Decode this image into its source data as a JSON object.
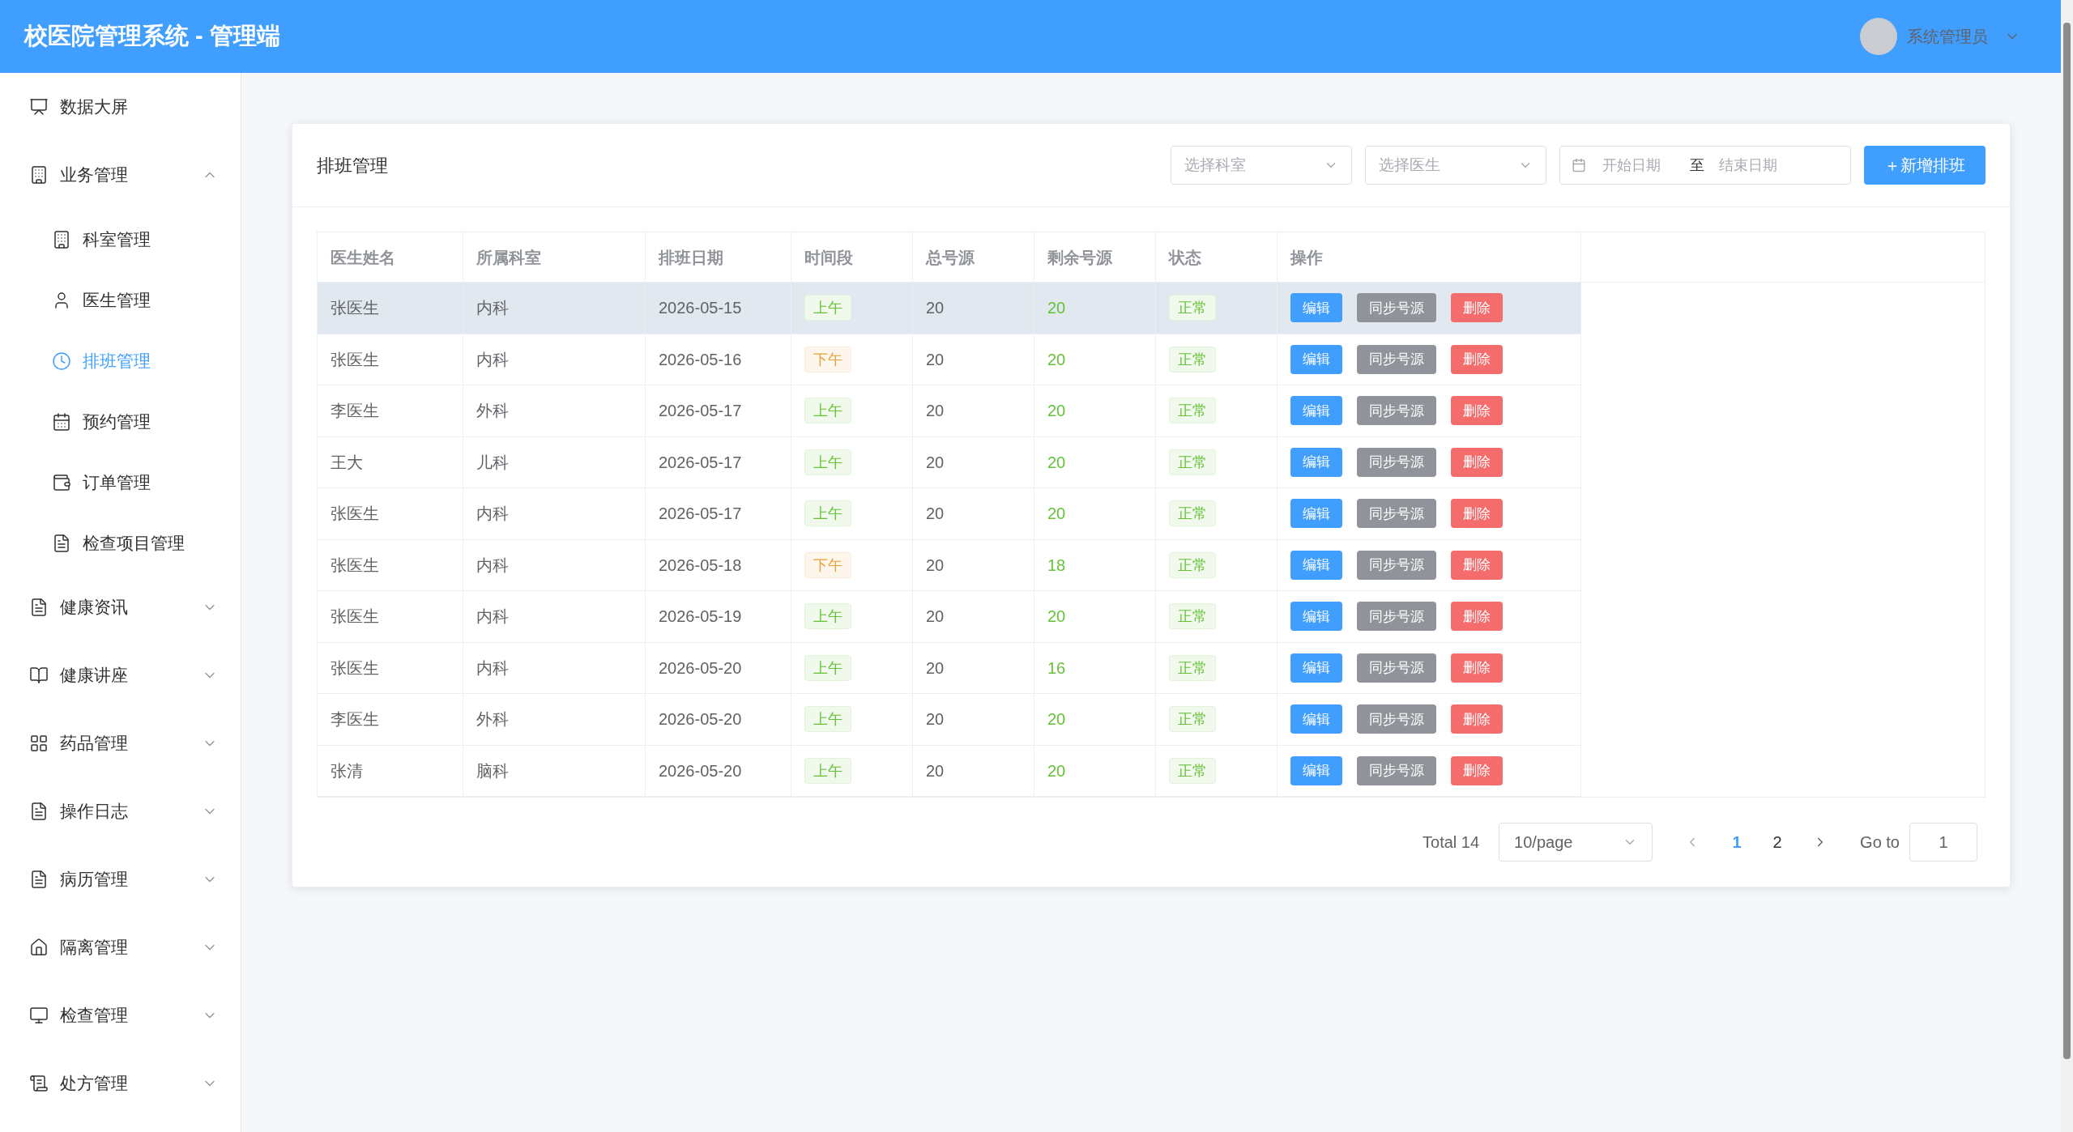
{
  "header": {
    "title": "校医院管理系统 - 管理端",
    "user": "系统管理员"
  },
  "sidebar": {
    "items": [
      {
        "label": "数据大屏",
        "selected": false
      },
      {
        "label": "业务管理",
        "selected": false,
        "expanded": true,
        "children": [
          {
            "label": "科室管理",
            "selected": false
          },
          {
            "label": "医生管理",
            "selected": false
          },
          {
            "label": "排班管理",
            "selected": true
          },
          {
            "label": "预约管理",
            "selected": false
          },
          {
            "label": "订单管理",
            "selected": false
          },
          {
            "label": "检查项目管理",
            "selected": false
          }
        ]
      },
      {
        "label": "健康资讯",
        "selected": false,
        "expanded": false
      },
      {
        "label": "健康讲座",
        "selected": false,
        "expanded": false
      },
      {
        "label": "药品管理",
        "selected": false,
        "expanded": false
      },
      {
        "label": "操作日志",
        "selected": false,
        "expanded": false
      },
      {
        "label": "病历管理",
        "selected": false,
        "expanded": false
      },
      {
        "label": "隔离管理",
        "selected": false,
        "expanded": false
      },
      {
        "label": "检查管理",
        "selected": false,
        "expanded": false
      },
      {
        "label": "处方管理",
        "selected": false,
        "expanded": false
      }
    ]
  },
  "card": {
    "title": "排班管理",
    "filters": {
      "department": {
        "placeholder": "选择科室"
      },
      "doctor": {
        "placeholder": "选择医生"
      },
      "date_range": {
        "start_placeholder": "开始日期",
        "separator": "至",
        "end_placeholder": "结束日期"
      },
      "add_button": "＋新增排班"
    },
    "table": {
      "columns": [
        "医生姓名",
        "所属科室",
        "排班日期",
        "时间段",
        "总号源",
        "剩余号源",
        "状态",
        "操作"
      ],
      "rows": [
        {
          "doctor": "张医生",
          "department": "内科",
          "date": "2026-05-15",
          "period": {
            "text": "上午",
            "kind": "success"
          },
          "total": "20",
          "remaining": "20",
          "status": {
            "text": "正常",
            "kind": "success"
          },
          "hovered": true,
          "actions": [
            {
              "label": "编辑",
              "kind": "primary"
            },
            {
              "label": "同步号源",
              "kind": "info"
            },
            {
              "label": "删除",
              "kind": "danger"
            }
          ]
        },
        {
          "doctor": "张医生",
          "department": "内科",
          "date": "2026-05-16",
          "period": {
            "text": "下午",
            "kind": "warning"
          },
          "total": "20",
          "remaining": "20",
          "status": {
            "text": "正常",
            "kind": "success"
          },
          "hovered": false,
          "actions": [
            {
              "label": "编辑",
              "kind": "primary"
            },
            {
              "label": "同步号源",
              "kind": "info"
            },
            {
              "label": "删除",
              "kind": "danger"
            }
          ]
        },
        {
          "doctor": "李医生",
          "department": "外科",
          "date": "2026-05-17",
          "period": {
            "text": "上午",
            "kind": "success"
          },
          "total": "20",
          "remaining": "20",
          "status": {
            "text": "正常",
            "kind": "success"
          },
          "hovered": false,
          "actions": [
            {
              "label": "编辑",
              "kind": "primary"
            },
            {
              "label": "同步号源",
              "kind": "info"
            },
            {
              "label": "删除",
              "kind": "danger"
            }
          ]
        },
        {
          "doctor": "王大",
          "department": "儿科",
          "date": "2026-05-17",
          "period": {
            "text": "上午",
            "kind": "success"
          },
          "total": "20",
          "remaining": "20",
          "status": {
            "text": "正常",
            "kind": "success"
          },
          "hovered": false,
          "actions": [
            {
              "label": "编辑",
              "kind": "primary"
            },
            {
              "label": "同步号源",
              "kind": "info"
            },
            {
              "label": "删除",
              "kind": "danger"
            }
          ]
        },
        {
          "doctor": "张医生",
          "department": "内科",
          "date": "2026-05-17",
          "period": {
            "text": "上午",
            "kind": "success"
          },
          "total": "20",
          "remaining": "20",
          "status": {
            "text": "正常",
            "kind": "success"
          },
          "hovered": false,
          "actions": [
            {
              "label": "编辑",
              "kind": "primary"
            },
            {
              "label": "同步号源",
              "kind": "info"
            },
            {
              "label": "删除",
              "kind": "danger"
            }
          ]
        },
        {
          "doctor": "张医生",
          "department": "内科",
          "date": "2026-05-18",
          "period": {
            "text": "下午",
            "kind": "warning"
          },
          "total": "20",
          "remaining": "18",
          "status": {
            "text": "正常",
            "kind": "success"
          },
          "hovered": false,
          "actions": [
            {
              "label": "编辑",
              "kind": "primary"
            },
            {
              "label": "同步号源",
              "kind": "info"
            },
            {
              "label": "删除",
              "kind": "danger"
            }
          ]
        },
        {
          "doctor": "张医生",
          "department": "内科",
          "date": "2026-05-19",
          "period": {
            "text": "上午",
            "kind": "success"
          },
          "total": "20",
          "remaining": "20",
          "status": {
            "text": "正常",
            "kind": "success"
          },
          "hovered": false,
          "actions": [
            {
              "label": "编辑",
              "kind": "primary"
            },
            {
              "label": "同步号源",
              "kind": "info"
            },
            {
              "label": "删除",
              "kind": "danger"
            }
          ]
        },
        {
          "doctor": "张医生",
          "department": "内科",
          "date": "2026-05-20",
          "period": {
            "text": "上午",
            "kind": "success"
          },
          "total": "20",
          "remaining": "16",
          "status": {
            "text": "正常",
            "kind": "success"
          },
          "hovered": false,
          "actions": [
            {
              "label": "编辑",
              "kind": "primary"
            },
            {
              "label": "同步号源",
              "kind": "info"
            },
            {
              "label": "删除",
              "kind": "danger"
            }
          ]
        },
        {
          "doctor": "李医生",
          "department": "外科",
          "date": "2026-05-20",
          "period": {
            "text": "上午",
            "kind": "success"
          },
          "total": "20",
          "remaining": "20",
          "status": {
            "text": "正常",
            "kind": "success"
          },
          "hovered": false,
          "actions": [
            {
              "label": "编辑",
              "kind": "primary"
            },
            {
              "label": "同步号源",
              "kind": "info"
            },
            {
              "label": "删除",
              "kind": "danger"
            }
          ]
        },
        {
          "doctor": "张清",
          "department": "脑科",
          "date": "2026-05-20",
          "period": {
            "text": "上午",
            "kind": "success"
          },
          "total": "20",
          "remaining": "20",
          "status": {
            "text": "正常",
            "kind": "success"
          },
          "hovered": false,
          "actions": [
            {
              "label": "编辑",
              "kind": "primary"
            },
            {
              "label": "同步号源",
              "kind": "info"
            },
            {
              "label": "删除",
              "kind": "danger"
            }
          ]
        }
      ]
    },
    "pagination": {
      "total": "Total 14",
      "page_size": "10/page",
      "pages": [
        {
          "label": "1",
          "selected": true
        },
        {
          "label": "2",
          "selected": false
        }
      ],
      "goto_label": "Go to",
      "goto_value": "1"
    }
  }
}
